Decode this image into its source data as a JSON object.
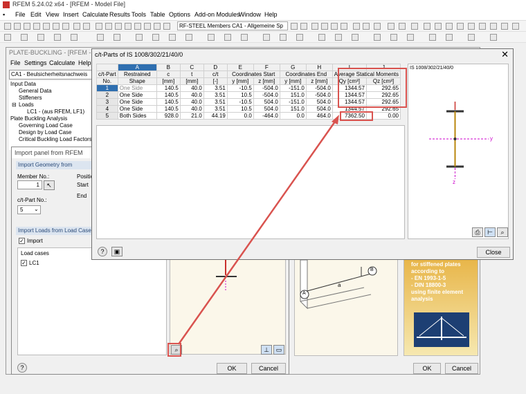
{
  "app": {
    "title": "RFEM 5.24.02 x64 - [RFEM - Model File]",
    "menu": [
      "File",
      "Edit",
      "View",
      "Insert",
      "Calculate",
      "Results",
      "Tools",
      "Table",
      "Options",
      "Add-on Modules",
      "Window",
      "Help"
    ],
    "module_combo": "RF-STEEL Members CA1 - Allgemeine Sp"
  },
  "plate_buckling": {
    "title": "PLATE-BUCKLING - [RFEM - Model",
    "menu": [
      "File",
      "Settings",
      "Calculate",
      "Help"
    ],
    "case_combo": "CA1 - Beulsicherheitsnachweis",
    "nav": [
      "Input Data",
      "General Data",
      "Stiffeners",
      "Loads",
      "LC1 - (aus RFEM, LF1)",
      "Plate Buckling Analysis",
      "Governing Load Case",
      "Design by Load Case",
      "Critical Buckling Load Factors"
    ],
    "logo_text": [
      "for stiffened plates",
      "according to",
      "- EN 1993-1-5",
      "- DIN 18800-3",
      "using finite element",
      "analysis"
    ],
    "dim_a": "a",
    "node_a": "A",
    "node_b": "B",
    "ok": "OK",
    "cancel": "Cancel"
  },
  "import_panel": {
    "title": "Import panel from RFEM",
    "geometry_header": "Import Geometry from",
    "member_label": "Member No.:",
    "member_value": "1",
    "position_label": "Position",
    "start_label": "Start",
    "end_label": "End",
    "ct_part_label": "c/t-Part No.:",
    "ct_part_value": "5",
    "loads_header": "Import Loads from Load Case",
    "import_label": "Import",
    "load_cases_label": "Load cases",
    "lc1": "LC1",
    "ok": "OK",
    "cancel": "Cancel"
  },
  "ct_dialog": {
    "title": "c/t-Parts of IS 1008/302/21/40/0",
    "graphic_title": "IS 1008/302/21/40/0",
    "graphic_axis_y": "y",
    "graphic_axis_z": "z",
    "close": "Close",
    "letters": [
      "A",
      "B",
      "C",
      "D",
      "E",
      "F",
      "G",
      "H",
      "I",
      "J"
    ],
    "header_row1": [
      "c/t-Part",
      "Restrained",
      "c",
      "t",
      "c/t",
      "Coordinates Start",
      "Coordinates End",
      "Average Statical Moments"
    ],
    "header_row2": [
      "No.",
      "Shape",
      "[mm]",
      "[mm]",
      "[-]",
      "y [mm]",
      "z [mm]",
      "y [mm]",
      "z [mm]",
      "Qy [cm³]",
      "Qz [cm³]"
    ],
    "rows": [
      {
        "no": "1",
        "shape": "One Side",
        "c": "140.5",
        "t": "40.0",
        "ct": "3.51",
        "ys": "-10.5",
        "zs": "-504.0",
        "ye": "-151.0",
        "ze": "-504.0",
        "qy": "1344.57",
        "qz": "292.65"
      },
      {
        "no": "2",
        "shape": "One Side",
        "c": "140.5",
        "t": "40.0",
        "ct": "3.51",
        "ys": "10.5",
        "zs": "-504.0",
        "ye": "151.0",
        "ze": "-504.0",
        "qy": "1344.57",
        "qz": "292.65"
      },
      {
        "no": "3",
        "shape": "One Side",
        "c": "140.5",
        "t": "40.0",
        "ct": "3.51",
        "ys": "-10.5",
        "zs": "504.0",
        "ye": "-151.0",
        "ze": "504.0",
        "qy": "1344.57",
        "qz": "292.65"
      },
      {
        "no": "4",
        "shape": "One Side",
        "c": "140.5",
        "t": "40.0",
        "ct": "3.51",
        "ys": "10.5",
        "zs": "504.0",
        "ye": "151.0",
        "ze": "504.0",
        "qy": "1344.57",
        "qz": "292.65"
      },
      {
        "no": "5",
        "shape": "Both Sides",
        "c": "928.0",
        "t": "21.0",
        "ct": "44.19",
        "ys": "0.0",
        "zs": "-464.0",
        "ye": "0.0",
        "ze": "464.0",
        "qy": "7362.50",
        "qz": "0.00"
      }
    ]
  },
  "colors": {
    "highlight": "#d9534f",
    "selection": "#2f6fb0"
  }
}
